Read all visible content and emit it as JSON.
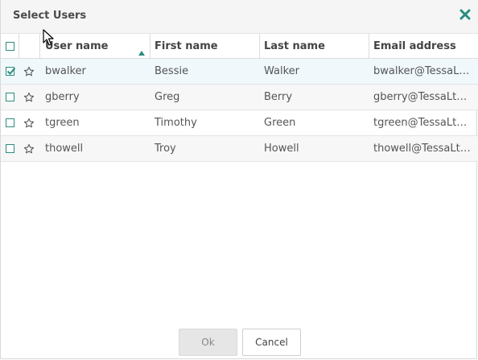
{
  "dialog": {
    "title": "Select Users",
    "close_icon": "close-icon",
    "accent_color": "#2a8c7f"
  },
  "table": {
    "columns": {
      "username": "User name",
      "first": "First name",
      "last": "Last name",
      "email": "Email address"
    },
    "sort": {
      "column": "username",
      "direction": "ascending"
    },
    "rows": [
      {
        "selected": true,
        "starred": false,
        "username": "bwalker",
        "first": "Bessie",
        "last": "Walker",
        "email": "bwalker@TessaLtd.de"
      },
      {
        "selected": false,
        "starred": false,
        "username": "gberry",
        "first": "Greg",
        "last": "Berry",
        "email": "gberry@TessaLtd.de"
      },
      {
        "selected": false,
        "starred": false,
        "username": "tgreen",
        "first": "Timothy",
        "last": "Green",
        "email": "tgreen@TessaLtd.de"
      },
      {
        "selected": false,
        "starred": false,
        "username": "thowell",
        "first": "Troy",
        "last": "Howell",
        "email": "thowell@TessaLtd.de"
      }
    ]
  },
  "buttons": {
    "ok": "Ok",
    "cancel": "Cancel"
  }
}
